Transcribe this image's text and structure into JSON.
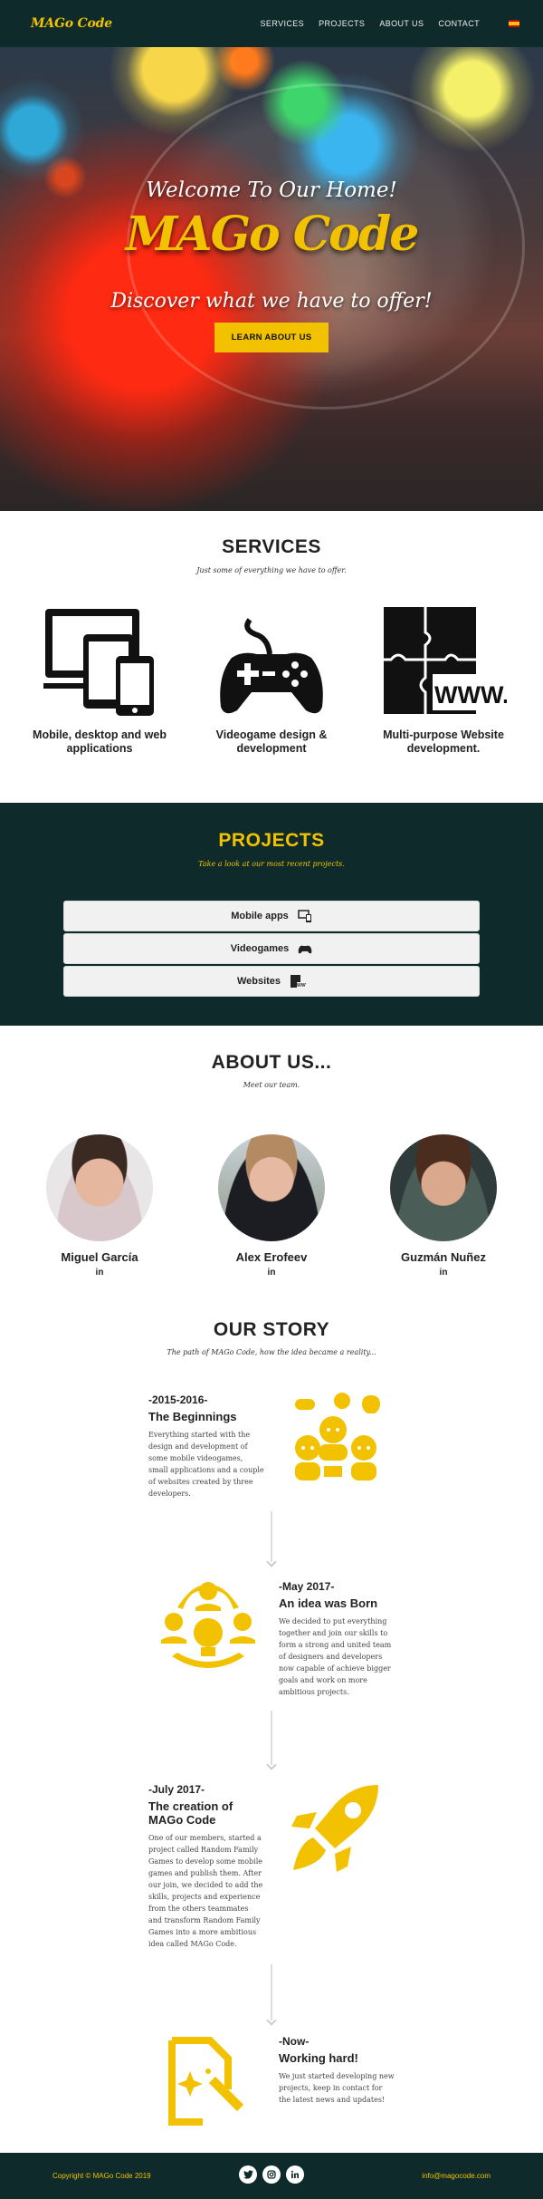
{
  "nav": {
    "logo": "MAGo Code",
    "items": [
      "SERVICES",
      "PROJECTS",
      "ABOUT US",
      "CONTACT"
    ]
  },
  "hero": {
    "welcome": "Welcome To Our Home!",
    "title": "MAGo Code",
    "subtitle": "Discover what we have to offer!",
    "button": "LEARN ABOUT US"
  },
  "services": {
    "title": "SERVICES",
    "subtitle": "Just some of everything we have to offer.",
    "items": [
      {
        "label": "Mobile, desktop and web applications",
        "icon": "devices-icon"
      },
      {
        "label": "Videogame design & development",
        "icon": "gamepad-icon"
      },
      {
        "label": "Multi-purpose Website development.",
        "icon": "puzzle-www-icon"
      }
    ]
  },
  "projects": {
    "title": "PROJECTS",
    "subtitle": "Take a look at our most recent projects.",
    "items": [
      "Mobile apps",
      "Videogames",
      "Websites"
    ],
    "accent": "#f2c200",
    "background": "#0e2a2a"
  },
  "about": {
    "title": "ABOUT US...",
    "subtitle": "Meet our team.",
    "members": [
      {
        "name": "Miguel García",
        "link": "in"
      },
      {
        "name": "Alex Erofeev",
        "link": "in"
      },
      {
        "name": "Guzmán Nuñez",
        "link": "in"
      }
    ]
  },
  "story": {
    "title": "OUR STORY",
    "subtitle": "The path of MAGo Code, how the idea became a reality...",
    "events": [
      {
        "date": "-2015-2016-",
        "head": "The Beginnings",
        "text": "Everything started with the design and development of some mobile videogames, small applications and a couple of websites created by three developers."
      },
      {
        "date": "-May 2017-",
        "head": "An idea was Born",
        "text": "We decided to put everything together and join our skills to form a strong and united team of designers and developers now capable of achieve bigger goals and work on more ambitious projects."
      },
      {
        "date": "-July 2017-",
        "head": "The creation of MAGo Code",
        "text": "One of our members, started a project called Random Family Games to develop some mobile games and publish them. After our join, we decided to add the skills, projects and experience from the others teammates and transform Random Family Games into a more ambitious idea called MAGo Code."
      },
      {
        "date": "-Now-",
        "head": "Working hard!",
        "text": "We just started developing new projects, keep in contact for the latest news and updates!"
      }
    ]
  },
  "footer": {
    "copyright": "Copyright © MAGo Code 2019",
    "email": "info@magocode.com",
    "social": [
      "twitter-icon",
      "instagram-icon",
      "linkedin-icon"
    ]
  }
}
